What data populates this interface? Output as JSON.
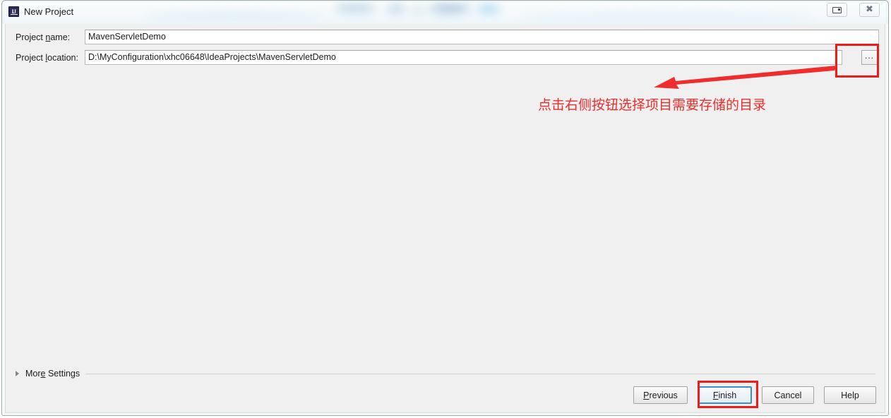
{
  "window": {
    "title": "New Project",
    "app_icon_name": "intellij-idea-icon",
    "app_icon_text": "IJ",
    "controls": [
      {
        "name": "restore-button",
        "icon": "restore-window-icon",
        "glyph": "❐"
      },
      {
        "name": "close-button",
        "icon": "close-window-icon",
        "glyph": "✖"
      }
    ]
  },
  "form": {
    "project_name": {
      "label_prefix": "Project ",
      "label_mnemonic": "n",
      "label_suffix": "ame:",
      "value": "MavenServletDemo",
      "placeholder": ""
    },
    "project_location": {
      "label_prefix": "Project ",
      "label_mnemonic": "l",
      "label_suffix": "ocation:",
      "value": "D:\\MyConfiguration\\xhc06648\\IdeaProjects\\MavenServletDemo",
      "placeholder": ""
    },
    "browse_button_label": "..."
  },
  "footer": {
    "more_settings": {
      "label_prefix": "Mor",
      "label_mnemonic": "e",
      "label_suffix": " Settings",
      "expanded": false
    },
    "buttons": [
      {
        "name": "previous-button",
        "prefix": "",
        "mnemonic": "P",
        "suffix": "revious",
        "focused": false
      },
      {
        "name": "finish-button",
        "prefix": "",
        "mnemonic": "F",
        "suffix": "inish",
        "focused": true
      },
      {
        "name": "cancel-button",
        "prefix": "",
        "mnemonic": "",
        "suffix": "Cancel",
        "focused": false
      },
      {
        "name": "help-button",
        "prefix": "",
        "mnemonic": "",
        "suffix": "Help",
        "focused": false
      }
    ]
  },
  "annotations": {
    "color": "#ef2d2d",
    "callout_text": "点击右侧按钮选择项目需要存储的目录",
    "boxes": [
      {
        "name": "annotation-box-browse-button",
        "target": "browse-button"
      },
      {
        "name": "annotation-box-finish-button",
        "target": "finish-button"
      }
    ],
    "arrow": {
      "name": "annotation-arrow",
      "direction": "right-to-left"
    }
  },
  "colors": {
    "dialog_background": "#f0f0f0",
    "field_background": "#ffffff",
    "focus_border": "#3c8ccf",
    "annotation_red": "#ef2d2d",
    "title_bar": "#f6fafc"
  }
}
